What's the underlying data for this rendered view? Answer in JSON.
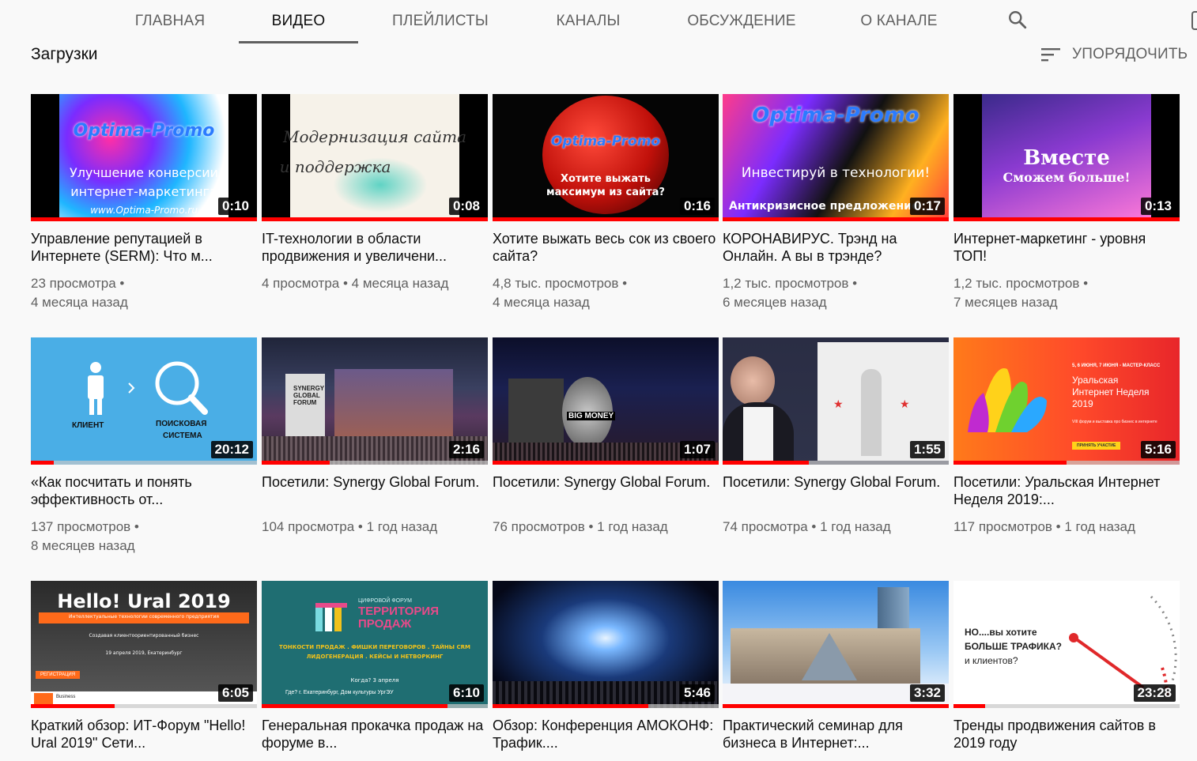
{
  "tabs": [
    {
      "label": "ГЛАВНАЯ",
      "active": false
    },
    {
      "label": "ВИДЕО",
      "active": true
    },
    {
      "label": "ПЛЕЙЛИСТЫ",
      "active": false
    },
    {
      "label": "КАНАЛЫ",
      "active": false
    },
    {
      "label": "ОБСУЖДЕНИЕ",
      "active": false
    },
    {
      "label": "О КАНАЛЕ",
      "active": false
    }
  ],
  "section": {
    "title": "Загрузки",
    "sort_label": "УПОРЯДОЧИТЬ"
  },
  "videos": [
    {
      "title": "Управление репутацией в Интернете (SERM): Что м...",
      "duration": "0:10",
      "meta1": "23 просмотра •",
      "meta2": "4 месяца назад",
      "progress": 1.0,
      "thumb_text": [
        "Optima-Promo",
        "Улучшение конверсии",
        "интернет-маркетинга",
        "www.Optima-Promo.ru"
      ]
    },
    {
      "title": "IT-технологии в области продвижения и увеличени...",
      "duration": "0:08",
      "meta1": "4 просмотра • 4 месяца назад",
      "meta2": "",
      "progress": 1.0,
      "thumb_text": [
        "Модернизация сайта",
        "и поддержка"
      ]
    },
    {
      "title": "Хотите выжать весь сок из своего сайта?",
      "duration": "0:16",
      "meta1": "4,8 тыс. просмотров •",
      "meta2": "4 месяца назад",
      "progress": 1.0,
      "thumb_text": [
        "Optima-Promo",
        "Хотите выжать",
        "максимум из сайта?"
      ]
    },
    {
      "title": "КОРОНАВИРУС. Трэнд на Онлайн. А вы в трэнде?",
      "duration": "0:17",
      "meta1": "1,2 тыс. просмотров •",
      "meta2": "6 месяцев назад",
      "progress": 1.0,
      "thumb_text": [
        "Optima-Promo",
        "Инвестируй в технологии!",
        "Антикризисное предложение"
      ]
    },
    {
      "title": "Интернет-маркетинг - уровня ТОП!",
      "duration": "0:13",
      "meta1": "1,2 тыс. просмотров •",
      "meta2": "7 месяцев назад",
      "progress": 1.0,
      "thumb_text": [
        "Вместе",
        "Сможем больше!"
      ]
    },
    {
      "title": "«Как посчитать и понять эффективность от...",
      "duration": "20:12",
      "meta1": "137 просмотров •",
      "meta2": "8 месяцев назад",
      "progress": 0.1,
      "thumb_text": [
        "КЛИЕНТ",
        "ПОИСКОВАЯ",
        "СИСТЕМА"
      ]
    },
    {
      "title": "Посетили: Synergy Global Forum.",
      "duration": "2:16",
      "meta1": "104 просмотра • 1 год назад",
      "meta2": "",
      "progress": 0.3,
      "thumb_text": [
        "SYNERGY",
        "GLOBAL",
        "FORUM"
      ]
    },
    {
      "title": "Посетили: Synergy Global Forum.",
      "duration": "1:07",
      "meta1": "76 просмотров • 1 год назад",
      "meta2": "",
      "progress": 1.0,
      "thumb_text": [
        "BIG MONEY"
      ]
    },
    {
      "title": "Посетили: Synergy Global Forum.",
      "duration": "1:55",
      "meta1": "74 просмотра • 1 год назад",
      "meta2": "",
      "progress": 0.38,
      "thumb_text": []
    },
    {
      "title": "Посетили: Уральская Интернет Неделя 2019:...",
      "duration": "5:16",
      "meta1": "117 просмотров • 1 год назад",
      "meta2": "",
      "progress": 0.5,
      "thumb_text": [
        "5, 6 ИЮНЯ, 7 ИЮНЯ - МАСТЕР-КЛАСС",
        "Уральская",
        "Интернет Неделя",
        "2019",
        "VIII форум и выставка про бизнес в интернете",
        "ПРИНЯТЬ УЧАСТИЕ"
      ]
    },
    {
      "title": "Краткий обзор: ИТ-Форум \"Hello! Ural 2019\" Сети...",
      "duration": "6:05",
      "meta1": "",
      "meta2": "",
      "progress": 0.37,
      "thumb_text": [
        "Hello! Ural 2019",
        "Интеллектуальные технологии современного предприятия",
        "Создавая клиентоориентированный бизнес",
        "19 апреля 2019, Екатеринбург",
        "РЕГИСТРАЦИЯ",
        "Business"
      ]
    },
    {
      "title": "Генеральная прокачка продаж на форуме в...",
      "duration": "6:10",
      "meta1": "",
      "meta2": "",
      "progress": 0.82,
      "thumb_text": [
        "ЦИФРОВОЙ ФОРУМ",
        "ТЕРРИТОРИЯ",
        "ПРОДАЖ",
        "ТОНКОСТИ ПРОДАЖ . ФИШКИ ПЕРЕГОВОРОВ . ТАЙНЫ CRM",
        "ЛИДОГЕНЕРАЦИЯ . КЕЙСЫ И НЕТВОРКИНГ",
        "Когда? 3 апреля",
        "Где? г. Екатеринбург, Дом культуры УргЭУ"
      ]
    },
    {
      "title": "Обзор: Конференция АМОКОНФ: Трафик....",
      "duration": "5:46",
      "meta1": "",
      "meta2": "",
      "progress": 0.69,
      "thumb_text": []
    },
    {
      "title": "Практический семинар для бизнеса в Интернет:...",
      "duration": "3:32",
      "meta1": "",
      "meta2": "",
      "progress": 1.0,
      "thumb_text": []
    },
    {
      "title": "Тренды продвижения сайтов в 2019 году",
      "duration": "23:28",
      "meta1": "",
      "meta2": "",
      "progress": 0.14,
      "thumb_text": [
        "НО....вы хотите",
        "БОЛЬШЕ ТРАФИКА?",
        "и клиентов?"
      ]
    }
  ]
}
